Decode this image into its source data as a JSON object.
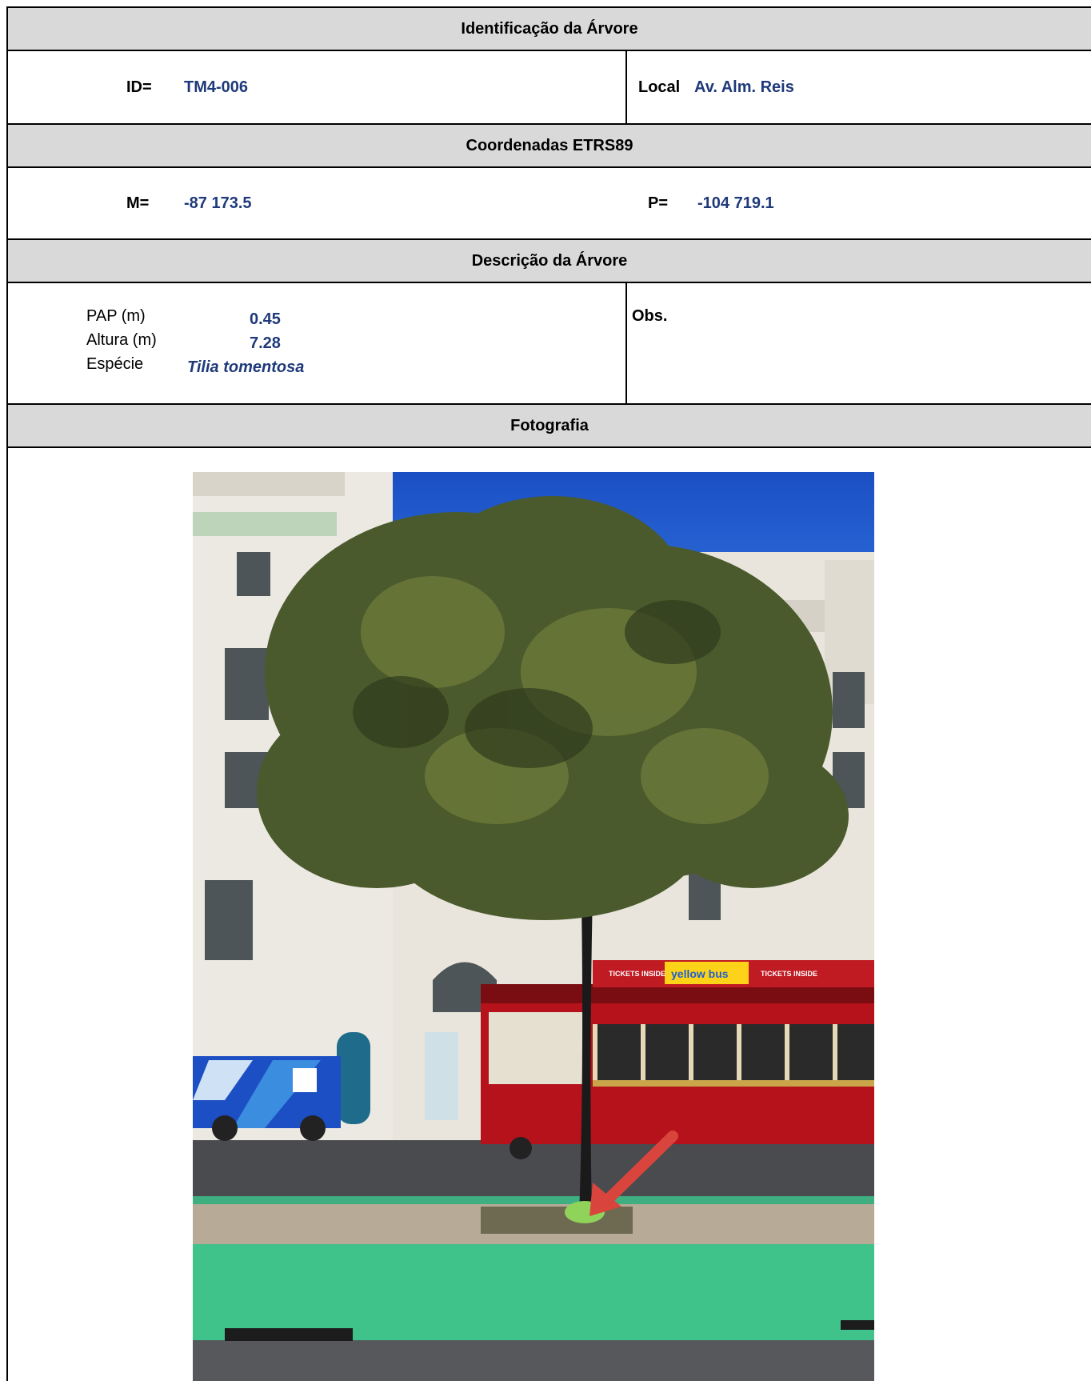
{
  "sections": {
    "identification": "Identificação da Árvore",
    "coordinates": "Coordenadas ETRS89",
    "description": "Descrição da Árvore",
    "photo": "Fotografia"
  },
  "identification": {
    "id_label": "ID=",
    "id_value": "TM4-006",
    "local_label": "Local",
    "local_value": "Av. Alm. Reis"
  },
  "coordinates": {
    "m_label": "M=",
    "m_value": "-87 173.5",
    "p_label": "P=",
    "p_value": "-104 719.1"
  },
  "description": {
    "pap_label": "PAP (m)",
    "pap_value": "0.45",
    "altura_label": "Altura (m)",
    "altura_value": "7.28",
    "especie_label": "Espécie",
    "especie_value": "Tilia tomentosa",
    "obs_label": "Obs."
  },
  "photo": {
    "bus_sign": "yellow bus",
    "tickets_sign": "TICKETS INSIDE",
    "colors": {
      "sky": "#1f5fd0",
      "tram_red": "#b5121b",
      "bike_lane": "#3fc38a",
      "arrow": "#d9453c"
    }
  }
}
